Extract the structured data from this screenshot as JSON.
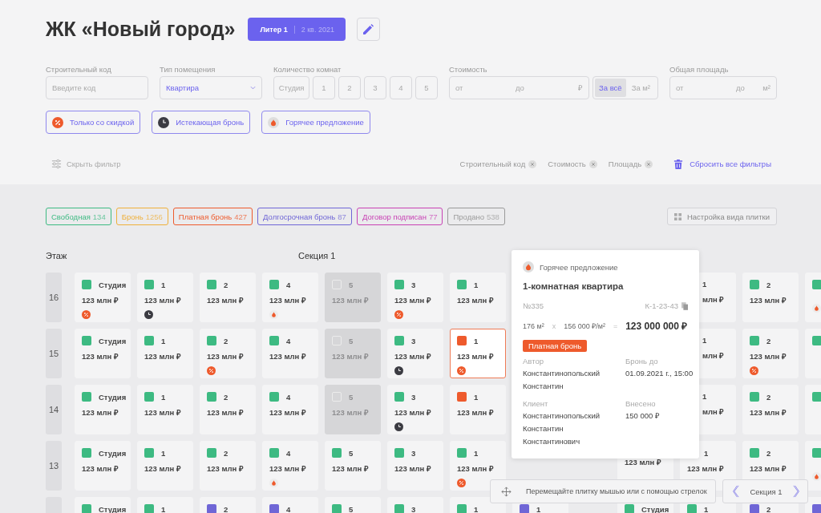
{
  "header": {
    "title": "ЖК «Новый город»",
    "building": "Литер 1",
    "quarter": "2 кв. 2021"
  },
  "filters": {
    "code": {
      "label": "Строительный код",
      "placeholder": "Введите код"
    },
    "type": {
      "label": "Тип помещения",
      "value": "Квартира"
    },
    "rooms": {
      "label": "Количество комнат",
      "options": [
        {
          "label": "Студия",
          "selected": false
        },
        {
          "label": "1",
          "selected": false
        },
        {
          "label": "2",
          "selected": false
        },
        {
          "label": "3",
          "selected": false
        },
        {
          "label": "4",
          "selected": false
        },
        {
          "label": "5",
          "selected": false
        }
      ]
    },
    "cost": {
      "label": "Стоимость",
      "from": "от",
      "to": "до",
      "unit": "₽",
      "modes": [
        {
          "label": "За всё",
          "selected": true
        },
        {
          "label": "За м²",
          "selected": false
        }
      ]
    },
    "area": {
      "label": "Общая площадь",
      "from": "от",
      "to": "до",
      "unit": "м²"
    }
  },
  "chips": [
    {
      "label": "Только со скидкой",
      "kind": "discount"
    },
    {
      "label": "Истекающая бронь",
      "kind": "clock"
    },
    {
      "label": "Горячее предложение",
      "kind": "fire"
    }
  ],
  "hide_filter": "Скрыть фильтр",
  "active_filters": [
    "Строительный код",
    "Стоимость",
    "Площадь"
  ],
  "reset": "Сбросить все фильтры",
  "legend": [
    {
      "label": "Свободная",
      "count": "134",
      "color": "#3dba82"
    },
    {
      "label": "Бронь",
      "count": "1256",
      "color": "#efb03a"
    },
    {
      "label": "Платная бронь",
      "count": "427",
      "color": "#ee5a2c"
    },
    {
      "label": "Долгосрочная бронь",
      "count": "87",
      "color": "#6f66d6"
    },
    {
      "label": "Договор подписан",
      "count": "77",
      "color": "#c842b4"
    },
    {
      "label": "Продано",
      "count": "538",
      "color": "#9a9a9a"
    }
  ],
  "tile_settings": "Настройка вида плитки",
  "floor_heading": "Этаж",
  "section_heading": "Секция 1",
  "rows": [
    {
      "floor": "16",
      "sections": [
        [
          {
            "kind": "tile",
            "rooms": "Студия",
            "price": "123 млн ₽",
            "color": "#3dba82",
            "badge": {
              "kind": "discount"
            },
            "selected": false
          },
          {
            "kind": "tile",
            "rooms": "1",
            "price": "123 млн ₽",
            "color": "#3dba82",
            "badge": {
              "kind": "clock"
            },
            "selected": false
          },
          {
            "kind": "tile",
            "rooms": "2",
            "price": "123 млн ₽",
            "color": "#3dba82",
            "selected": false
          },
          {
            "kind": "tile",
            "rooms": "4",
            "price": "123 млн ₽",
            "color": "#3dba82",
            "badge": {
              "kind": "fire"
            },
            "selected": false
          },
          {
            "kind": "sold",
            "rooms": "5",
            "price": "123 млн ₽"
          },
          {
            "kind": "tile",
            "rooms": "3",
            "price": "123 млн ₽",
            "color": "#3dba82",
            "badge": {
              "kind": "discount"
            },
            "selected": false
          },
          {
            "kind": "tile",
            "rooms": "1",
            "price": "123 млн ₽",
            "color": "#3dba82",
            "selected": false
          },
          {
            "kind": "empty"
          }
        ],
        [
          {
            "kind": "empty"
          },
          {
            "kind": "partial",
            "rooms": "1",
            "price": "млн ₽"
          },
          {
            "kind": "tile",
            "rooms": "2",
            "price": "123 млн ₽",
            "color": "#3dba82",
            "selected": false
          },
          {
            "kind": "edge",
            "color": "#3dba82",
            "badge": {
              "kind": "fire"
            }
          }
        ]
      ]
    },
    {
      "floor": "15",
      "sections": [
        [
          {
            "kind": "tile",
            "rooms": "Студия",
            "price": "123 млн ₽",
            "color": "#3dba82",
            "selected": false
          },
          {
            "kind": "tile",
            "rooms": "1",
            "price": "123 млн ₽",
            "color": "#3dba82",
            "selected": false
          },
          {
            "kind": "tile",
            "rooms": "2",
            "price": "123 млн ₽",
            "color": "#3dba82",
            "badge": {
              "kind": "discount"
            },
            "selected": false
          },
          {
            "kind": "tile",
            "rooms": "4",
            "price": "123 млн ₽",
            "color": "#3dba82",
            "selected": false
          },
          {
            "kind": "sold",
            "rooms": "5",
            "price": "123 млн ₽"
          },
          {
            "kind": "tile",
            "rooms": "3",
            "price": "123 млн ₽",
            "color": "#3dba82",
            "badge": {
              "kind": "clock"
            },
            "selected": false
          },
          {
            "kind": "tile",
            "rooms": "1",
            "price": "123 млн ₽",
            "color": "#ee5a2c",
            "badge": {
              "kind": "discount"
            },
            "selected": true
          },
          {
            "kind": "empty"
          }
        ],
        [
          {
            "kind": "empty"
          },
          {
            "kind": "partial",
            "rooms": "1",
            "price": "млн ₽"
          },
          {
            "kind": "tile",
            "rooms": "2",
            "price": "123 млн ₽",
            "color": "#3dba82",
            "badge": {
              "kind": "discount"
            },
            "selected": false
          },
          {
            "kind": "edge",
            "color": "#3dba82"
          }
        ]
      ]
    },
    {
      "floor": "14",
      "sections": [
        [
          {
            "kind": "tile",
            "rooms": "Студия",
            "price": "123 млн ₽",
            "color": "#3dba82",
            "selected": false
          },
          {
            "kind": "tile",
            "rooms": "1",
            "price": "123 млн ₽",
            "color": "#3dba82",
            "selected": false
          },
          {
            "kind": "tile",
            "rooms": "2",
            "price": "123 млн ₽",
            "color": "#3dba82",
            "selected": false
          },
          {
            "kind": "tile",
            "rooms": "4",
            "price": "123 млн ₽",
            "color": "#3dba82",
            "selected": false
          },
          {
            "kind": "sold",
            "rooms": "5",
            "price": "123 млн ₽"
          },
          {
            "kind": "tile",
            "rooms": "3",
            "price": "123 млн ₽",
            "color": "#3dba82",
            "badge": {
              "kind": "clock"
            },
            "selected": false
          },
          {
            "kind": "tile",
            "rooms": "1",
            "price": "123 млн ₽",
            "color": "#ee5a2c",
            "selected": false
          },
          {
            "kind": "empty"
          }
        ],
        [
          {
            "kind": "empty"
          },
          {
            "kind": "partial",
            "rooms": "1",
            "price": "млн ₽"
          },
          {
            "kind": "tile",
            "rooms": "2",
            "price": "123 млн ₽",
            "color": "#3dba82",
            "selected": false
          },
          {
            "kind": "edge",
            "color": "#3dba82"
          }
        ]
      ]
    },
    {
      "floor": "13",
      "sections": [
        [
          {
            "kind": "tile",
            "rooms": "Студия",
            "price": "123 млн ₽",
            "color": "#3dba82",
            "selected": false
          },
          {
            "kind": "tile",
            "rooms": "1",
            "price": "123 млн ₽",
            "color": "#3dba82",
            "selected": false
          },
          {
            "kind": "tile",
            "rooms": "2",
            "price": "123 млн ₽",
            "color": "#3dba82",
            "selected": false
          },
          {
            "kind": "tile",
            "rooms": "4",
            "price": "123 млн ₽",
            "color": "#3dba82",
            "badge": {
              "kind": "fire"
            },
            "selected": false
          },
          {
            "kind": "tile",
            "rooms": "5",
            "price": "123 млн ₽",
            "color": "#3dba82",
            "selected": false
          },
          {
            "kind": "tile",
            "rooms": "3",
            "price": "123 млн ₽",
            "color": "#3dba82",
            "selected": false
          },
          {
            "kind": "tile",
            "rooms": "1",
            "price": "123 млн ₽",
            "color": "#3dba82",
            "badge": {
              "kind": "discount"
            },
            "selected": false
          },
          {
            "kind": "empty"
          }
        ],
        [
          {
            "kind": "lower",
            "price": "123 млн ₽"
          },
          {
            "kind": "notch",
            "rooms": "1",
            "price": "123 млн ₽"
          },
          {
            "kind": "tile",
            "rooms": "2",
            "price": "123 млн ₽",
            "color": "#3dba82",
            "selected": false
          },
          {
            "kind": "edge",
            "color": "#3dba82",
            "badge": {
              "kind": "fire"
            }
          }
        ]
      ]
    },
    {
      "sections": [
        [
          {
            "kind": "tile",
            "rooms": "Студия",
            "color": "#3dba82",
            "selected": false
          },
          {
            "kind": "tile",
            "rooms": "1",
            "color": "#3dba82",
            "selected": false
          },
          {
            "kind": "tile",
            "rooms": "2",
            "color": "#6f66d6",
            "selected": false
          },
          {
            "kind": "tile",
            "rooms": "4",
            "color": "#6f66d6",
            "selected": false
          },
          {
            "kind": "tile",
            "rooms": "5",
            "color": "#3dba82",
            "selected": false
          },
          {
            "kind": "tile",
            "rooms": "3",
            "color": "#3dba82",
            "selected": false
          },
          {
            "kind": "tile",
            "rooms": "1",
            "color": "#3dba82",
            "selected": false
          },
          {
            "kind": "tile",
            "rooms": "1",
            "color": "#6f66d6",
            "selected": false
          }
        ],
        [
          {
            "kind": "tile",
            "rooms": "Студия",
            "color": "#3dba82",
            "selected": false
          },
          {
            "kind": "tile",
            "rooms": "1",
            "color": "#3dba82",
            "selected": false
          },
          {
            "kind": "tile",
            "rooms": "2",
            "color": "#6f66d6",
            "selected": false
          },
          {
            "kind": "edge",
            "color": "#6f66d6"
          }
        ]
      ]
    }
  ],
  "popup": {
    "tag": "Горячее предложение",
    "title": "1-комнатная квартира",
    "number": "№335",
    "code": "К-1-23-43",
    "area": "176 м²",
    "times": "x",
    "unit_price": "156 000 ₽/м²",
    "equals": "=",
    "total": "123 000 000 ₽",
    "status": {
      "label": "Платная бронь",
      "color": "#ee5a2c"
    },
    "fields": [
      {
        "label": "Автор",
        "lines": [
          "Константинопольский",
          "Константин"
        ]
      },
      {
        "label": "Бронь до",
        "lines": [
          "01.09.2021 г., 15:00"
        ]
      },
      {
        "label": "Клиент",
        "lines": [
          "Константинопольский",
          "Константин",
          "Константинович"
        ]
      },
      {
        "label": "Внесено",
        "lines": [
          "150 000 ₽"
        ]
      }
    ]
  },
  "hint": "Перемещайте плитку мышью или с помощью стрелок",
  "section_nav": "Секция 1"
}
